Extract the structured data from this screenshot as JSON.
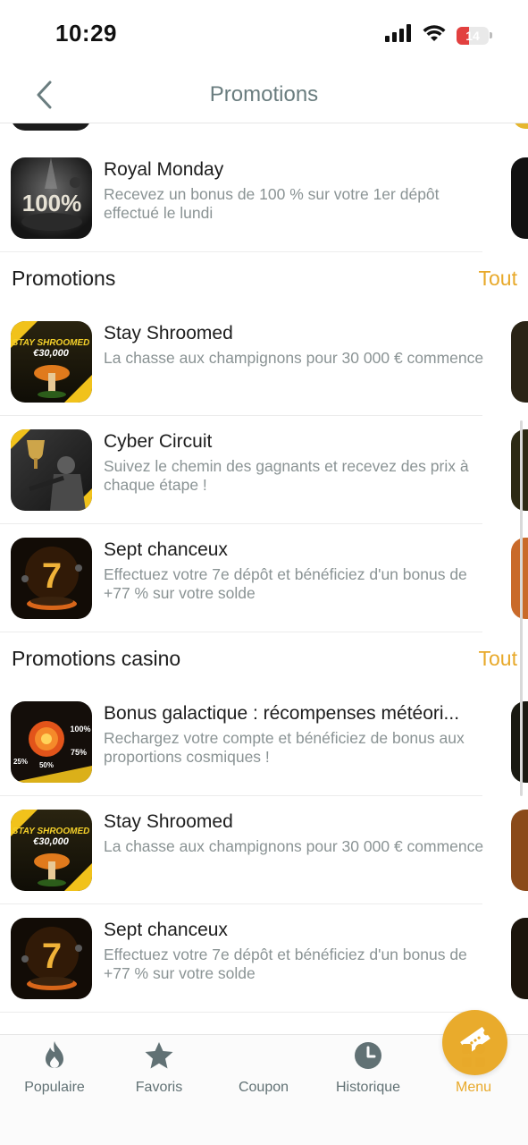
{
  "status_bar": {
    "time": "10:29",
    "battery": "14"
  },
  "nav": {
    "title": "Promotions",
    "back_icon": "chevron-left-icon"
  },
  "top_item": {
    "title": "Royal Monday",
    "description": "Recevez un bonus de 100 % sur votre 1er dépôt effectué le lundi",
    "thumb_text": "100%"
  },
  "sections": [
    {
      "title": "Promotions",
      "link": "Tout",
      "items": [
        {
          "title": "Stay Shroomed",
          "description": "La chasse aux champignons pour 30 000 € commence",
          "thumb_line1": "STAY SHROOMED",
          "thumb_line2": "€30,000"
        },
        {
          "title": "Cyber Circuit",
          "description": "Suivez le chemin des gagnants et recevez des prix à chaque étape !"
        },
        {
          "title": "Sept chanceux",
          "description": "Effectuez votre 7e dépôt et bénéficiez d'un bonus de +77 % sur votre solde",
          "thumb_text": "7"
        }
      ]
    },
    {
      "title": "Promotions casino",
      "link": "Tout",
      "items": [
        {
          "title": "Bonus galactique : récompenses météori...",
          "description": "Rechargez votre compte et bénéficiez de bonus aux proportions cosmiques !",
          "thumb_labels": [
            "100%",
            "75%",
            "50%",
            "25%"
          ]
        },
        {
          "title": "Stay Shroomed",
          "description": "La chasse aux champignons pour 30 000 € commence",
          "thumb_line1": "STAY SHROOMED",
          "thumb_line2": "€30,000"
        },
        {
          "title": "Sept chanceux",
          "description": "Effectuez votre 7e dépôt et bénéficiez d'un bonus de +77 % sur votre solde",
          "thumb_text": "7"
        }
      ]
    }
  ],
  "tab_bar": {
    "tabs": [
      {
        "label": "Populaire",
        "icon": "flame-icon"
      },
      {
        "label": "Favoris",
        "icon": "star-icon"
      },
      {
        "label": "Coupon",
        "icon": "ticket-icon"
      },
      {
        "label": "Historique",
        "icon": "clock-icon"
      },
      {
        "label": "Menu",
        "icon": "grid-icon",
        "active": true
      }
    ]
  },
  "colors": {
    "accent": "#e8a92a",
    "muted_text": "#8a9394",
    "title_gray": "#6a7d7f",
    "tab_gray": "#617174"
  }
}
